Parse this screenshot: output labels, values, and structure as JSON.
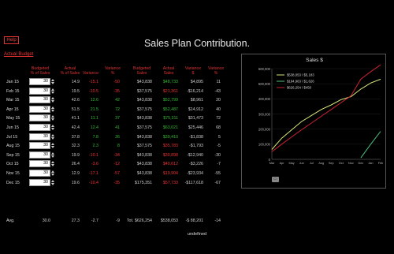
{
  "help_label": "Help",
  "title": "Sales Plan Contribution.",
  "actual_budget_link": "Actual Budget",
  "headers": {
    "budgeted_pct": "Budgeted\n% of Sales",
    "actual_pct": "Actual\n% of Sales",
    "variance": "Variance",
    "variance_pct": "Variance\n%",
    "budgeted_sales": "Budgeted\nSales",
    "actual_sales": "Actual\nSales",
    "variance_dollar": "Variance\n$",
    "variance_pct2": "Variance\n%"
  },
  "rows": [
    {
      "month": "Jan 15",
      "input": "30",
      "aps": "14.9",
      "var": "-15.1",
      "varp": "-50",
      "bud": "$43,838",
      "act": "$48,733",
      "vard": "$4,895",
      "varp2": "11",
      "vc": "red",
      "vpc": "red",
      "ac": "green",
      "vdc": "gray"
    },
    {
      "month": "Feb 15",
      "input": "30",
      "aps": "19.5",
      "var": "-10.5",
      "varp": "-35",
      "bud": "$37,575",
      "act": "$21,361",
      "vard": "-$16,214",
      "varp2": "-43",
      "vc": "red",
      "vpc": "red",
      "ac": "red",
      "vdc": "gray"
    },
    {
      "month": "Mar 15",
      "input": "30",
      "aps": "42.6",
      "var": "12.6",
      "varp": "42",
      "bud": "$43,838",
      "act": "$52,799",
      "vard": "$8,961",
      "varp2": "20",
      "vc": "green",
      "vpc": "green",
      "ac": "green",
      "vdc": "gray"
    },
    {
      "month": "Apr 15",
      "input": "30",
      "aps": "51.5",
      "var": "21.5",
      "varp": "72",
      "bud": "$37,575",
      "act": "$52,487",
      "vard": "$14,912",
      "varp2": "40",
      "vc": "green",
      "vpc": "green",
      "ac": "green",
      "vdc": "gray"
    },
    {
      "month": "May 15",
      "input": "30",
      "aps": "41.1",
      "var": "11.1",
      "varp": "37",
      "bud": "$43,838",
      "act": "$75,311",
      "vard": "$31,473",
      "varp2": "72",
      "vc": "green",
      "vpc": "green",
      "ac": "green",
      "vdc": "gray"
    },
    {
      "month": "Jun 15",
      "input": "30",
      "aps": "42.4",
      "var": "12.4",
      "varp": "41",
      "bud": "$37,575",
      "act": "$63,021",
      "vard": "$25,446",
      "varp2": "68",
      "vc": "green",
      "vpc": "green",
      "ac": "green",
      "vdc": "gray"
    },
    {
      "month": "Jul 15",
      "input": "30",
      "aps": "37.8",
      "var": "7.8",
      "varp": "26",
      "bud": "$43,838",
      "act": "$39,410",
      "vard": "-$1,838",
      "varp2": "5",
      "vc": "green",
      "vpc": "green",
      "ac": "green",
      "vdc": "gray"
    },
    {
      "month": "Aug 15",
      "input": "30",
      "aps": "32.3",
      "var": "2.3",
      "varp": "8",
      "bud": "$37,575",
      "act": "$35,783",
      "vard": "-$1,793",
      "varp2": "-5",
      "vc": "green",
      "vpc": "green",
      "ac": "red",
      "vdc": "gray"
    },
    {
      "month": "Sep 15",
      "input": "30",
      "aps": "19.9",
      "var": "-10.1",
      "varp": "-34",
      "bud": "$43,838",
      "act": "$30,898",
      "vard": "-$12,940",
      "varp2": "-30",
      "vc": "red",
      "vpc": "red",
      "ac": "red",
      "vdc": "gray"
    },
    {
      "month": "Oct 15",
      "input": "30",
      "aps": "26.4",
      "var": "-3.6",
      "varp": "-12",
      "bud": "$43,838",
      "act": "$40,612",
      "vard": "-$3,226",
      "varp2": "-7",
      "vc": "red",
      "vpc": "red",
      "ac": "red",
      "vdc": "gray"
    },
    {
      "month": "Nov 15",
      "input": "30",
      "aps": "12.9",
      "var": "-17.1",
      "varp": "-57",
      "bud": "$43,838",
      "act": "$19,904",
      "vard": "-$23,934",
      "varp2": "-55",
      "vc": "red",
      "vpc": "red",
      "ac": "red",
      "vdc": "gray"
    },
    {
      "month": "Dec 15",
      "input": "30",
      "aps": "19.6",
      "var": "-10.4",
      "varp": "-35",
      "bud": "$175,351",
      "act": "$57,733",
      "vard": "-$117,618",
      "varp2": "-67",
      "vc": "red",
      "vpc": "red",
      "ac": "red",
      "vdc": "gray"
    }
  ],
  "avg": {
    "label": "Avg.",
    "input": "30.0",
    "aps": "27.3",
    "var": "-2.7",
    "varp": "-9",
    "bud": "Tot. $626,254",
    "act": "$538,053",
    "vard": "-$ 88,201",
    "varp2": "-14"
  },
  "undefined_text": "undefined",
  "chart_button_label": "▭",
  "colors": {
    "accent_red": "#e33333",
    "positive_green": "#33bb33",
    "series_actual": "#d8e87a",
    "series_green": "#4fc080",
    "series_budget": "#cc2233"
  },
  "chart_data": {
    "type": "line",
    "title": "Sales $",
    "categories": [
      "Mar",
      "Apr",
      "May",
      "Jun",
      "Jul",
      "Aug",
      "Sep",
      "Oct",
      "Nov",
      "Dec",
      "Jan",
      "Feb"
    ],
    "ylim": [
      0,
      600000
    ],
    "yticks": [
      "0",
      "100,000",
      "200,000",
      "300,000",
      "400,000",
      "500,000",
      "600,000"
    ],
    "legend_placement": "top-left",
    "series": [
      {
        "name": "$538,053 / $5,183",
        "color": "#d8e87a",
        "values": [
          65000,
          140000,
          195000,
          250000,
          290000,
          330000,
          360000,
          395000,
          415000,
          465000,
          505000,
          530000
        ]
      },
      {
        "name": "$194,963 / $1,626",
        "color": "#4fc080",
        "values": [
          null,
          null,
          null,
          null,
          null,
          null,
          null,
          null,
          null,
          10000,
          100000,
          185000
        ]
      },
      {
        "name": "$626,254 / $450",
        "color": "#cc2233",
        "values": [
          50000,
          100000,
          148000,
          195000,
          240000,
          285000,
          330000,
          375000,
          420000,
          530000,
          580000,
          625000
        ]
      }
    ]
  }
}
